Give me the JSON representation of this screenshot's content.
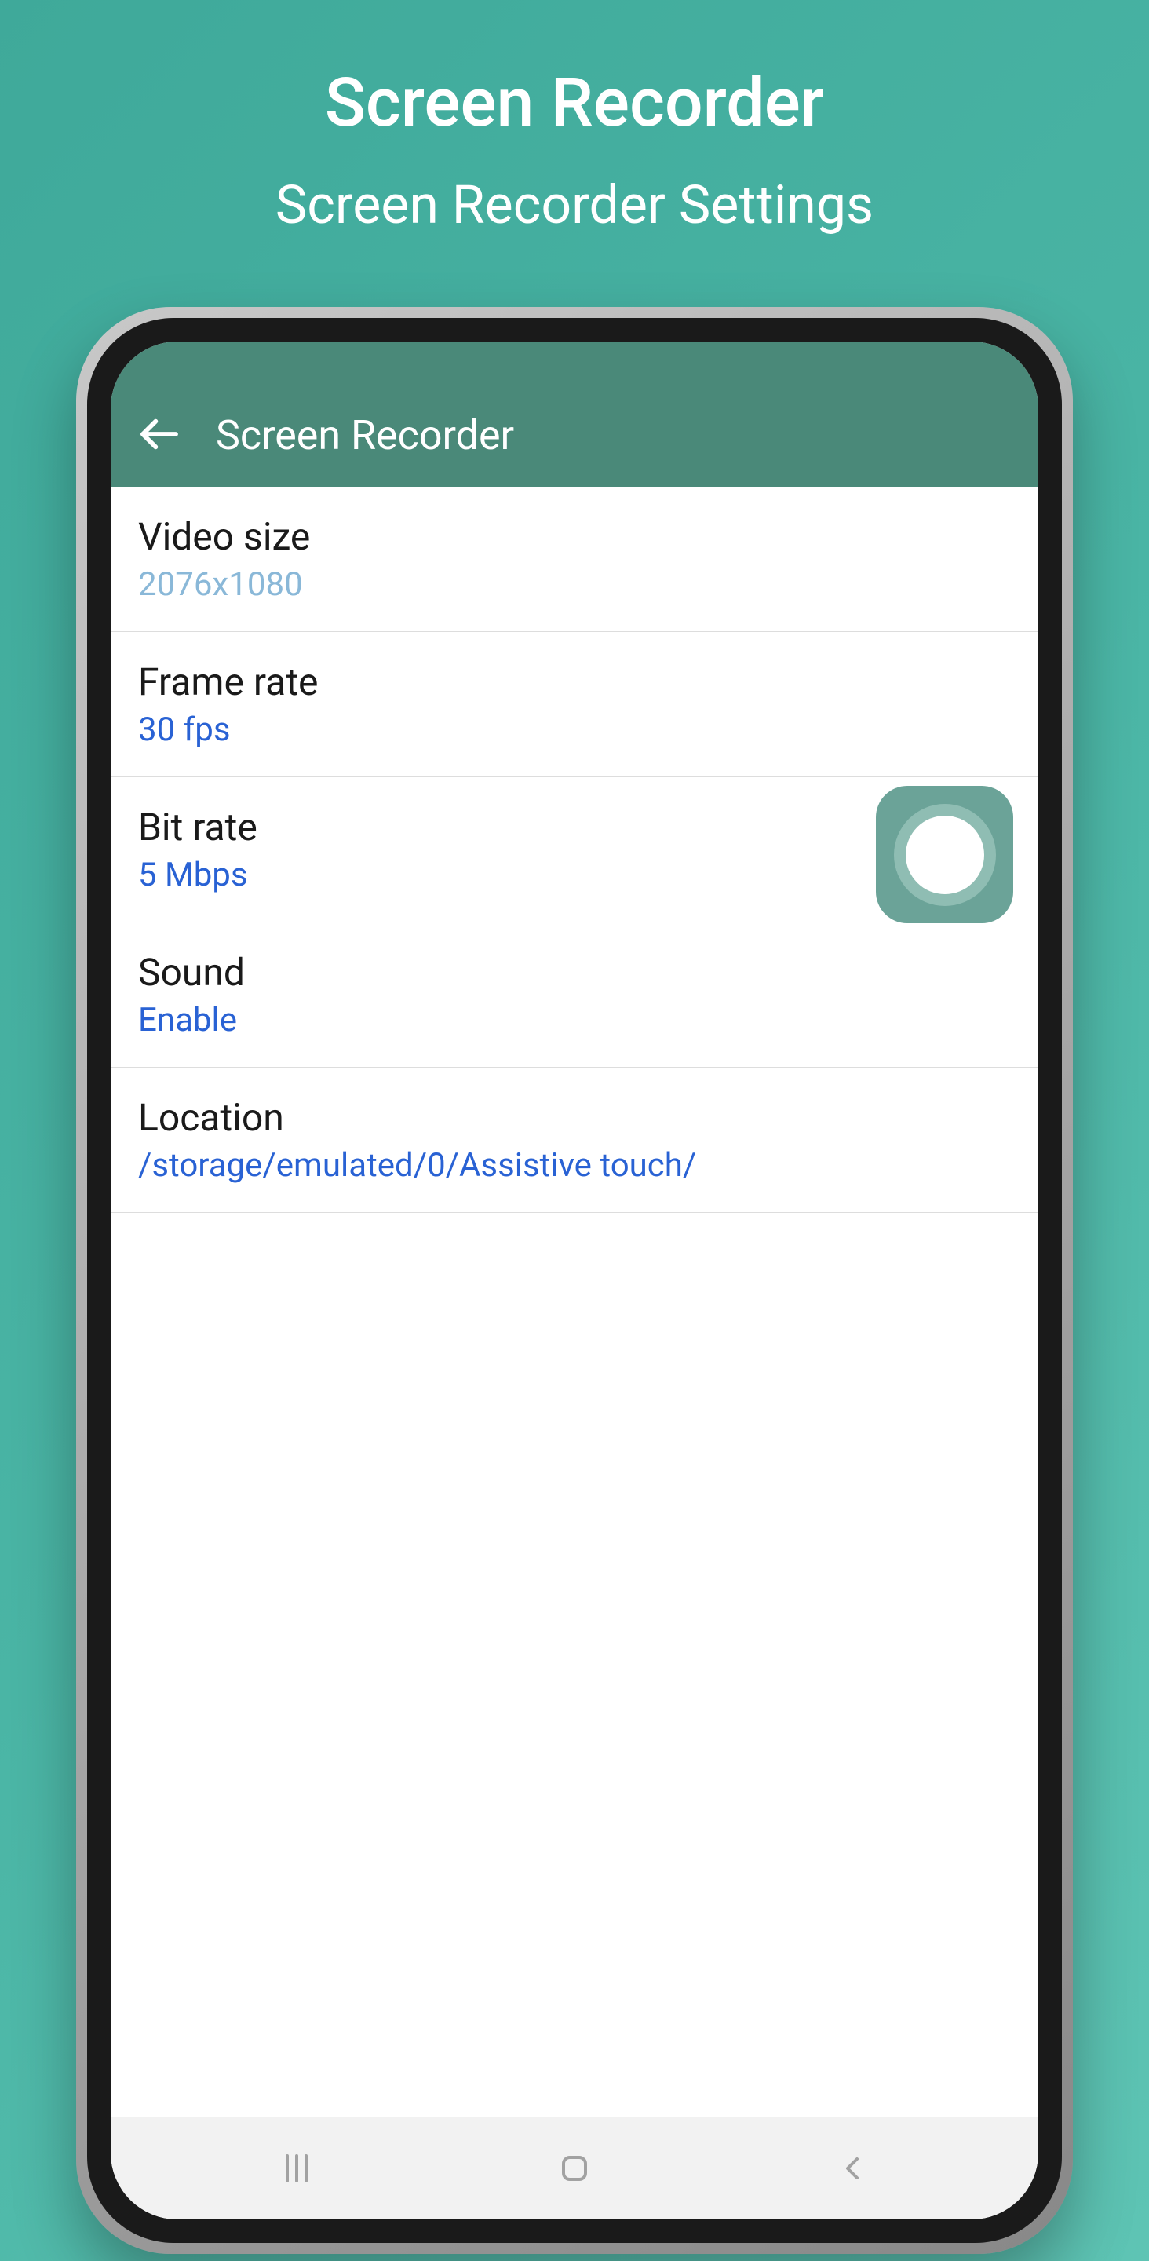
{
  "promo": {
    "title": "Screen Recorder",
    "subtitle": "Screen Recorder Settings"
  },
  "app": {
    "header_title": "Screen Recorder"
  },
  "settings": {
    "video_size": {
      "label": "Video size",
      "value": "2076x1080"
    },
    "frame_rate": {
      "label": "Frame rate",
      "value": "30 fps"
    },
    "bit_rate": {
      "label": "Bit rate",
      "value": "5 Mbps"
    },
    "sound": {
      "label": "Sound",
      "value": "Enable"
    },
    "location": {
      "label": "Location",
      "value": "/storage/emulated/0/Assistive touch/"
    }
  }
}
